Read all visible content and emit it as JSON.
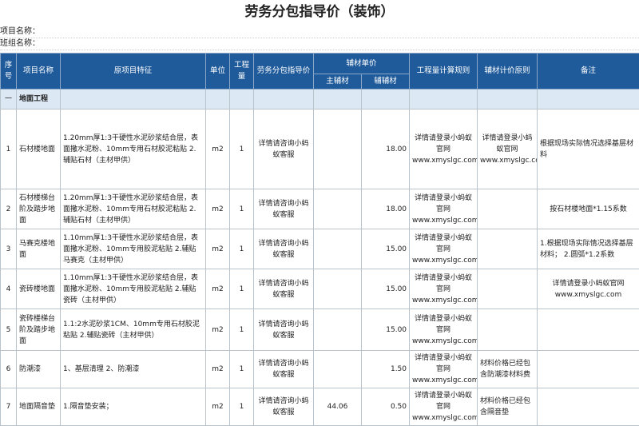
{
  "title": "劳务分包指导价（装饰）",
  "meta": {
    "project_label": "项目名称：",
    "team_label": "班组名称："
  },
  "headers": {
    "seq": "序号",
    "name": "项目名称",
    "feature": "原项目特征",
    "unit": "单位",
    "qty": "工程量",
    "labor_price": "劳务分包指导价",
    "aux_price": "辅材单价",
    "main_aux": "主辅材",
    "aux": "辅辅材",
    "rule": "工程量计算规则",
    "aux_rule": "辅材计价原则",
    "note": "备注"
  },
  "section": {
    "seq": "一",
    "name": "地面工程"
  },
  "rows": [
    {
      "seq": "1",
      "name": "石材楼地面",
      "feature": "1.20mm厚1:3干硬性水泥砂浆结合层，表面撒水泥粉、10mm专用石材胶泥粘贴 2.辅贴石材（主材甲供）",
      "unit": "m2",
      "qty": "1",
      "labor": "详情请咨询小蚂蚁客服",
      "main_aux": "",
      "aux": "18.00",
      "rule": "详情请登录小蚂蚁官网 www.xmyslgc.com",
      "aux_rule": "详情请登录小蚂蚁官网 www.xmyslgc.com",
      "note": "根据现场实际情况选择基层材料"
    },
    {
      "seq": "2",
      "name": "石材楼梯台阶及踏步地面",
      "feature": "1.20mm厚1:3干硬性水泥砂浆结合层，表面撒水泥粉、10mm专用石材胶泥粘贴 2.辅贴石材（主材甲供）",
      "unit": "m2",
      "qty": "1",
      "labor": "详情请咨询小蚂蚁客服",
      "main_aux": "",
      "aux": "18.00",
      "rule": "详情请登录小蚂蚁官网 www.xmyslgc.com",
      "aux_rule": "",
      "note": "按石材楼地面*1.15系数"
    },
    {
      "seq": "3",
      "name": "马赛克楼地面",
      "feature": "1.10mm厚1:3干硬性水泥砂浆结合层，表面撒水泥粉、10mm专用胶泥粘贴 2.辅贴马赛克（主材甲供）",
      "unit": "m2",
      "qty": "1",
      "labor": "详情请咨询小蚂蚁客服",
      "main_aux": "",
      "aux": "15.00",
      "rule": "详情请登录小蚂蚁官网 www.xmyslgc.com",
      "aux_rule": "",
      "note": "1.根据现场实际情况选择基层材料； 2.圆弧*1.2系数"
    },
    {
      "seq": "4",
      "name": "瓷砖楼地面",
      "feature": "1.10mm厚1:3干硬性水泥砂浆结合层，表面撒水泥粉、10mm专用胶泥粘贴 2.辅贴瓷砖（主材甲供）",
      "unit": "m2",
      "qty": "1",
      "labor": "详情请咨询小蚂蚁客服",
      "main_aux": "",
      "aux": "15.00",
      "rule": "详情请登录小蚂蚁官网 www.xmyslgc.com",
      "aux_rule": "",
      "note": "详情请登录小蚂蚁官网 www.xmyslgc.com"
    },
    {
      "seq": "5",
      "name": "瓷砖楼梯台阶及踏步地面",
      "feature": "1.1:2水泥砂浆1CM、10mm专用石材胶泥粘贴 2.辅贴瓷砖（主材甲供）",
      "unit": "m2",
      "qty": "1",
      "labor": "详情请咨询小蚂蚁客服",
      "main_aux": "",
      "aux": "15.00",
      "rule": "详情请登录小蚂蚁官网 www.xmyslgc.com",
      "aux_rule": "",
      "note": ""
    },
    {
      "seq": "6",
      "name": "防潮漆",
      "feature": "1、基层清理 2、防潮漆",
      "unit": "m2",
      "qty": "1",
      "labor": "详情请咨询小蚂蚁客服",
      "main_aux": "",
      "aux": "1.50",
      "rule": "详情请登录小蚂蚁官网 www.xmyslgc.com",
      "aux_rule": "材料价格已经包含防潮漆材料费",
      "note": ""
    },
    {
      "seq": "7",
      "name": "地面隔音垫",
      "feature": "1.隔音垫安装；",
      "unit": "m2",
      "qty": "1",
      "labor": "详情请咨询小蚂蚁客服",
      "main_aux": "44.06",
      "aux": "0.50",
      "rule": "详情请登录小蚂蚁官网 www.xmyslgc.com",
      "aux_rule": "材料价格已经包含隔音垫",
      "note": ""
    }
  ]
}
